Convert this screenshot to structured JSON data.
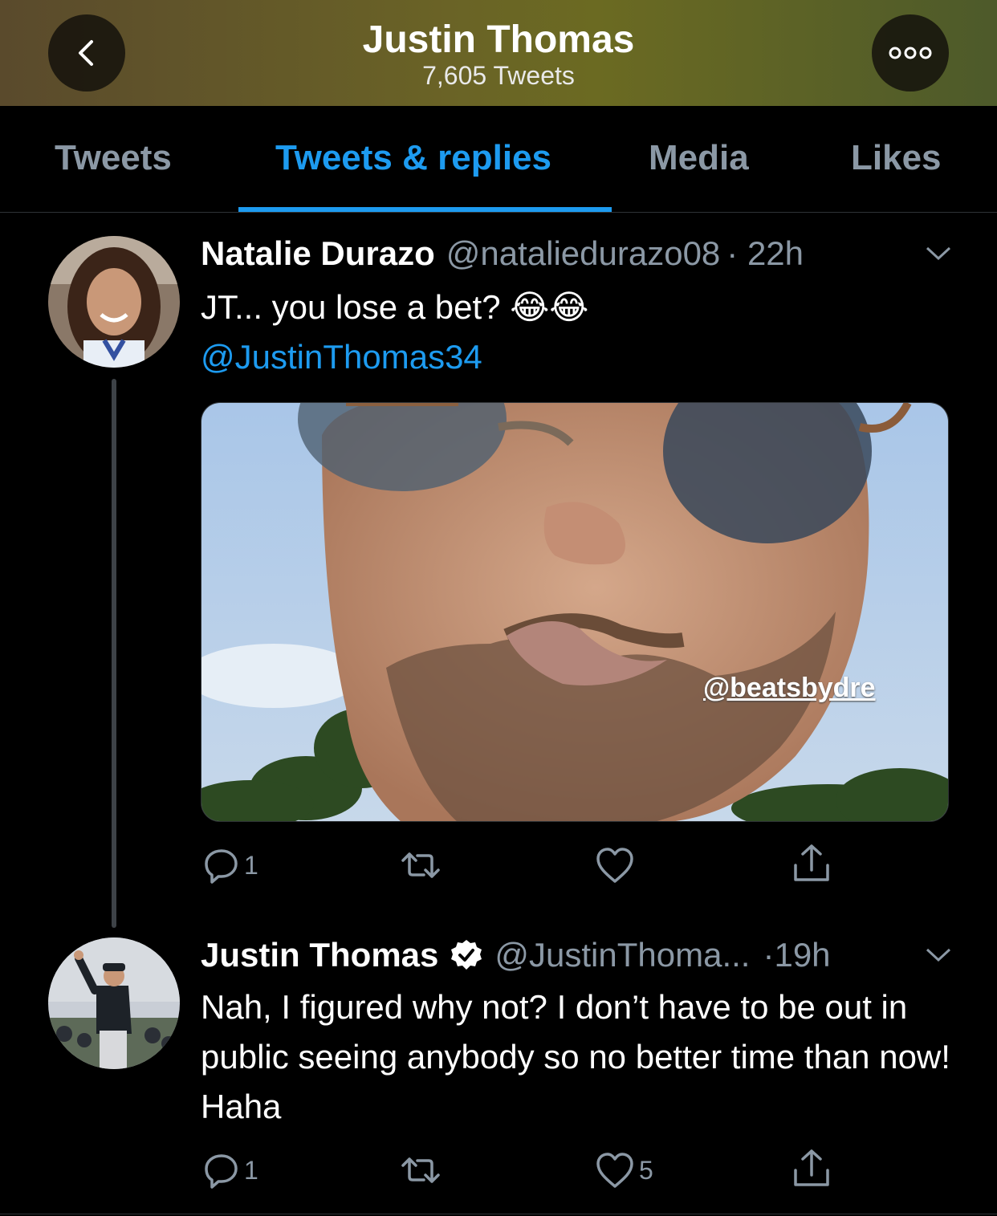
{
  "header": {
    "title": "Justin Thomas",
    "subtitle": "7,605 Tweets",
    "back_icon": "chevron-left-icon",
    "more_icon": "more-dots-icon",
    "bg_colors": [
      "#5a4a2c",
      "#6b6a22",
      "#4d5a2a"
    ]
  },
  "tabs": [
    {
      "label": "Tweets",
      "active": false
    },
    {
      "label": "Tweets & replies",
      "active": true
    },
    {
      "label": "Media",
      "active": false
    },
    {
      "label": "Likes",
      "active": false
    }
  ],
  "accent_color": "#1d9bf0",
  "tweets": [
    {
      "name": "Natalie Durazo",
      "handle": "@nataliedurazo08",
      "time": "· 22h",
      "text": "JT... you lose a bet? 😂😂",
      "mention": "@JustinThomas34",
      "media_watermark": "@beatsbydre",
      "replies": "1",
      "retweets": "",
      "likes": ""
    },
    {
      "name": "Justin Thomas",
      "verified": true,
      "handle": "@JustinThoma...",
      "time": "·19h",
      "text": "Nah, I figured why not? I don’t have to be out in public seeing anybody so no better time than now! Haha",
      "replies": "1",
      "retweets": "",
      "likes": "5"
    }
  ]
}
